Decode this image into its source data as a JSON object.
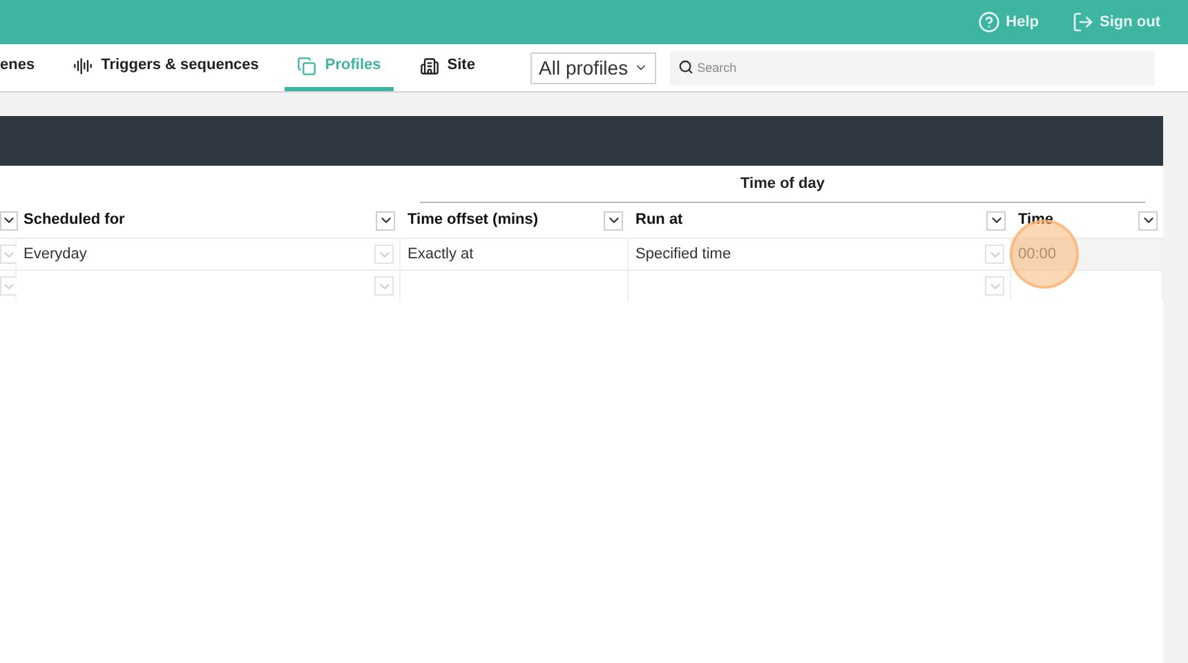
{
  "header": {
    "links": [
      {
        "kind": "help",
        "label": "Help"
      },
      {
        "kind": "signout",
        "label": "Sign out"
      }
    ]
  },
  "nav": {
    "tabs": [
      {
        "kind": "scenes",
        "label": "enes",
        "selected": false
      },
      {
        "kind": "triggers",
        "label": "Triggers & sequences",
        "selected": false
      },
      {
        "kind": "profiles",
        "label": "Profiles",
        "selected": true
      },
      {
        "kind": "site",
        "label": "Site",
        "selected": false
      }
    ],
    "profile_select": {
      "value": "All profiles"
    },
    "search": {
      "placeholder": "Search"
    }
  },
  "table": {
    "group_header": "Time of day",
    "columns": [
      {},
      {
        "label": "Scheduled for"
      },
      {
        "label": "Time offset (mins)"
      },
      {
        "label": "Run at"
      },
      {
        "label": "Time"
      }
    ],
    "rows": [
      {
        "cells": [
          {
            "kind": "select",
            "selected": false
          },
          {
            "text": "Everyday",
            "kind": "select",
            "selected": false
          },
          {
            "text": "Exactly at",
            "kind": "text",
            "selected": false
          },
          {
            "text": "Specified time",
            "kind": "select",
            "selected": false
          },
          {
            "text": "00:00",
            "kind": "text",
            "selected": true
          }
        ]
      },
      {
        "cells": [
          {
            "kind": "select",
            "selected": false
          },
          {
            "kind": "select",
            "selected": false
          },
          {
            "kind": "text",
            "selected": false
          },
          {
            "kind": "select",
            "selected": false
          },
          {
            "kind": "text",
            "selected": false
          }
        ]
      }
    ]
  }
}
